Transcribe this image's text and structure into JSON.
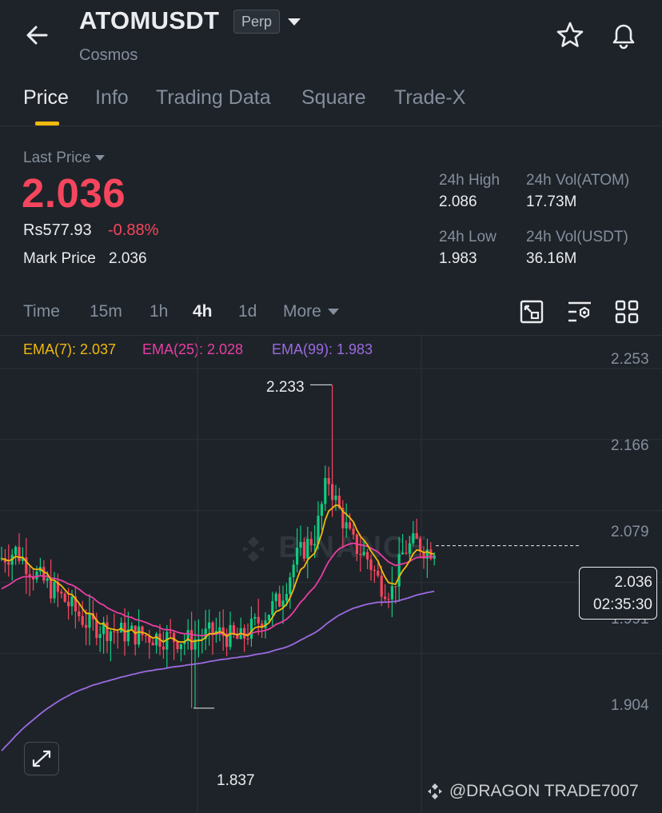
{
  "header": {
    "symbol": "ATOMUSDT",
    "badge": "Perp",
    "subtitle": "Cosmos",
    "icons": [
      "back-arrow-icon",
      "chevron-down-icon",
      "star-icon",
      "bell-icon"
    ]
  },
  "tabs": [
    "Price",
    "Info",
    "Trading Data",
    "Square",
    "Trade-X"
  ],
  "active_tab": "Price",
  "price": {
    "last_label": "Last Price",
    "last": "2.036",
    "fiat": "Rs577.93",
    "change": "-0.88%",
    "mark_label": "Mark Price",
    "mark": "2.036"
  },
  "stats": {
    "high_label": "24h High",
    "high": "2.086",
    "low_label": "24h Low",
    "low": "1.983",
    "vol_base_label": "24h Vol(ATOM)",
    "vol_base": "17.73M",
    "vol_quote_label": "24h Vol(USDT)",
    "vol_quote": "36.16M"
  },
  "intervals": [
    "Time",
    "15m",
    "1h",
    "4h",
    "1d",
    "More"
  ],
  "active_interval": "4h",
  "toolbar_icons": [
    "chart-style-icon",
    "indicator-settings-icon",
    "grid-layout-icon"
  ],
  "ema": {
    "ema7": "EMA(7): 2.037",
    "ema25": "EMA(25): 2.028",
    "ema99": "EMA(99): 1.983"
  },
  "colors": {
    "up": "#0ecb81",
    "down": "#f6465d",
    "accent": "#f0b90b",
    "ema7": "#f0b90b",
    "ema25": "#e83ea4",
    "ema99": "#9c6ae0"
  },
  "chart_data": {
    "type": "candlestick",
    "y_ticks": [
      "2.253",
      "2.166",
      "2.079",
      "1.991",
      "1.904"
    ],
    "ylim": [
      1.83,
      2.253
    ],
    "high_marker": "2.233",
    "low_marker": "1.837",
    "current_price": "2.036",
    "countdown": "02:35:30",
    "grid": true
  },
  "watermark": "BINANCE",
  "footer_mark": "@DRAGON TRADE7007"
}
